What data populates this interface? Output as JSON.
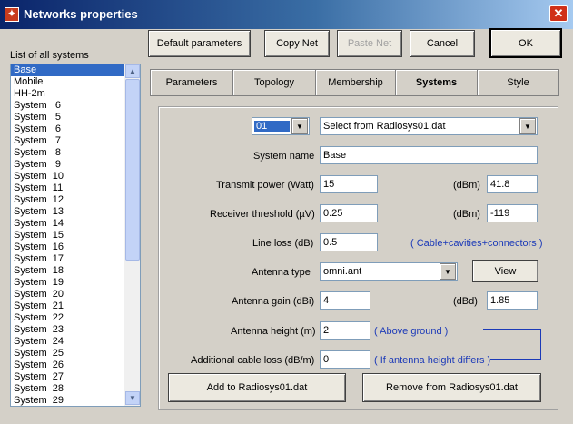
{
  "window": {
    "title": "Networks properties"
  },
  "toolbar": {
    "default_params": "Default parameters",
    "copy_net": "Copy Net",
    "paste_net": "Paste Net",
    "cancel": "Cancel",
    "ok": "OK"
  },
  "systems_list": {
    "label": "List of all systems",
    "items": [
      "Base",
      "Mobile",
      "HH-2m",
      "System   6",
      "System   5",
      "System   6",
      "System   7",
      "System   8",
      "System   9",
      "System  10",
      "System  11",
      "System  12",
      "System  13",
      "System  14",
      "System  15",
      "System  16",
      "System  17",
      "System  18",
      "System  19",
      "System  20",
      "System  21",
      "System  22",
      "System  23",
      "System  24",
      "System  25",
      "System  26",
      "System  27",
      "System  28",
      "System  29"
    ],
    "selected_index": 0
  },
  "tabs": [
    "Parameters",
    "Topology",
    "Membership",
    "Systems",
    "Style"
  ],
  "active_tab": "Systems",
  "systems": {
    "number": "01",
    "radiosys_select": "Select from Radiosys01.dat",
    "system_name_label": "System name",
    "system_name": "Base",
    "transmit_power_label": "Transmit power (Watt)",
    "transmit_power": "15",
    "transmit_power_unit": "(dBm)",
    "transmit_power_dbm": "41.8",
    "receiver_threshold_label": "Receiver threshold (µV)",
    "receiver_threshold": "0.25",
    "receiver_threshold_unit": "(dBm)",
    "receiver_threshold_dbm": "-119",
    "line_loss_label": "Line loss (dB)",
    "line_loss": "0.5",
    "line_loss_note": "( Cable+cavities+connectors )",
    "antenna_type_label": "Antenna type",
    "antenna_type": "omni.ant",
    "view_button": "View",
    "antenna_gain_label": "Antenna gain (dBi)",
    "antenna_gain": "4",
    "antenna_gain_unit": "(dBd)",
    "antenna_gain_dbd": "1.85",
    "antenna_height_label": "Antenna height (m)",
    "antenna_height": "2",
    "antenna_height_note": "( Above ground )",
    "additional_cable_loss_label": "Additional cable loss (dB/m)",
    "additional_cable_loss": "0",
    "additional_cable_loss_note": "( If antenna height differs )",
    "add_button": "Add to Radiosys01.dat",
    "remove_button": "Remove from Radiosys01.dat"
  },
  "colors": {
    "titlebar_start": "#0a246a",
    "selection": "#316ac5",
    "note_text": "#1c3ab8"
  }
}
